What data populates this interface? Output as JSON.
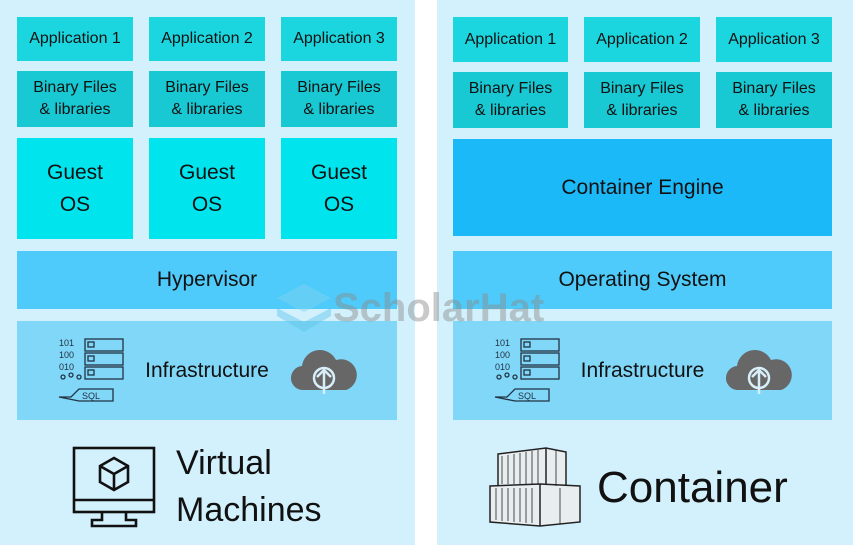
{
  "vm": {
    "apps": [
      "Application 1",
      "Application 2",
      "Application 3"
    ],
    "binaries": [
      "Binary Files\n& libraries",
      "Binary Files\n& libraries",
      "Binary Files\n& libraries"
    ],
    "guest_os": [
      "Guest\nOS",
      "Guest\nOS",
      "Guest\nOS"
    ],
    "hypervisor": "Hypervisor",
    "infrastructure": "Infrastructure",
    "title": "Virtual\nMachines"
  },
  "container": {
    "apps": [
      "Application 1",
      "Application 2",
      "Application 3"
    ],
    "binaries": [
      "Binary Files\n& libraries",
      "Binary Files\n& libraries",
      "Binary Files\n& libraries"
    ],
    "engine": "Container Engine",
    "os": "Operating System",
    "infrastructure": "Infrastructure",
    "title": "Container"
  },
  "watermark": "ScholarHat",
  "colors": {
    "panel": "#d3f1fd",
    "app": "#1cd6df",
    "binary": "#18c8d2",
    "guest_os": "#00e4ee",
    "hypervisor": "#4ecbfa",
    "engine": "#1bb9f8",
    "infra": "#81d7f8"
  }
}
